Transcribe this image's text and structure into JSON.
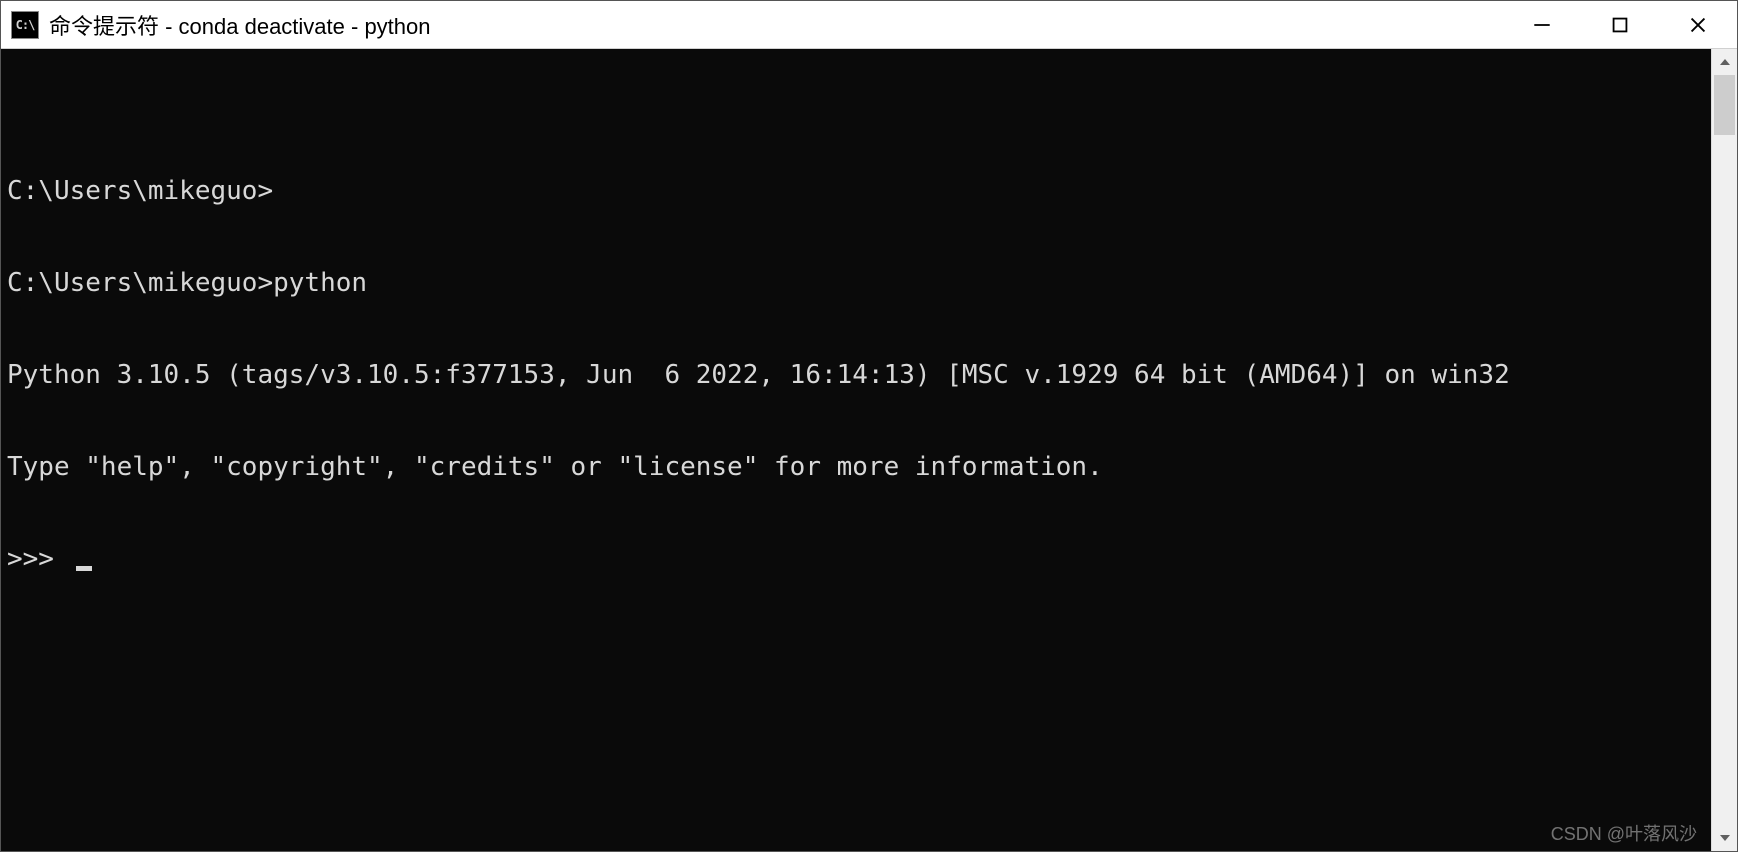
{
  "titlebar": {
    "icon_text": "C:\\",
    "title": "命令提示符 - conda  deactivate - python"
  },
  "terminal": {
    "blank1": "",
    "line1": "C:\\Users\\mikeguo>",
    "line2": "C:\\Users\\mikeguo>python",
    "line3": "Python 3.10.5 (tags/v3.10.5:f377153, Jun  6 2022, 16:14:13) [MSC v.1929 64 bit (AMD64)] on win32",
    "line4": "Type \"help\", \"copyright\", \"credits\" or \"license\" for more information.",
    "prompt": ">>> "
  },
  "watermark": "CSDN @叶落风沙"
}
